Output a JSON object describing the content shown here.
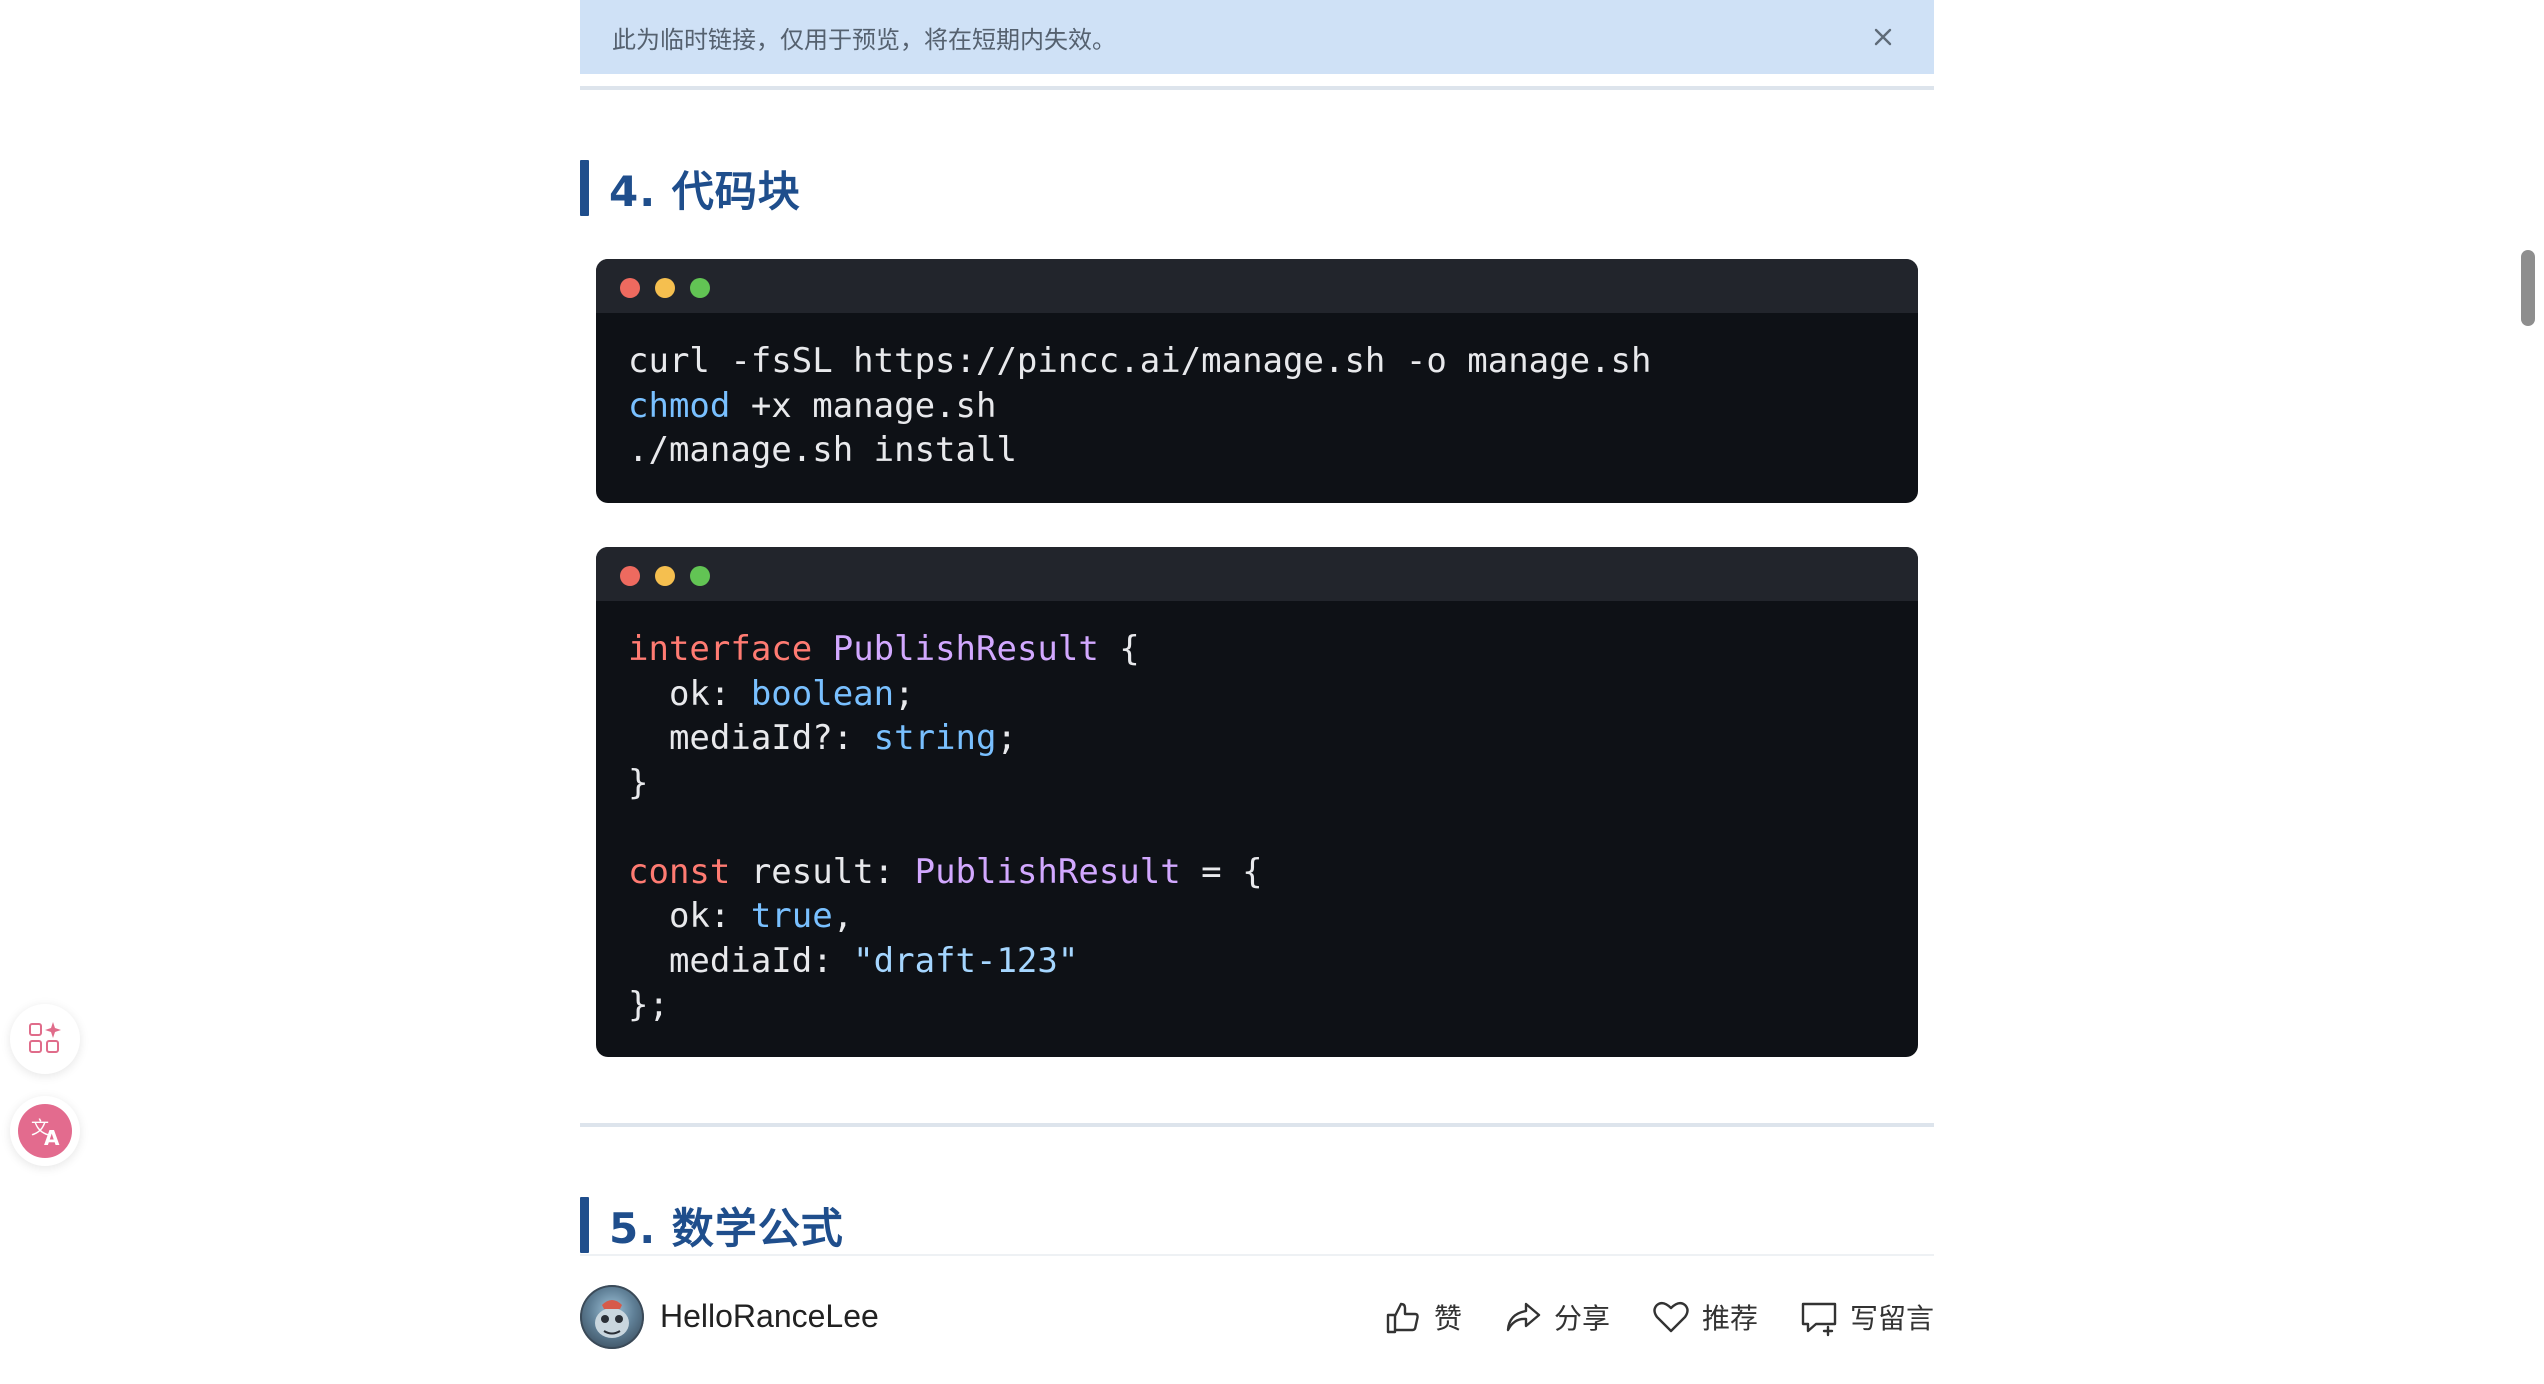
{
  "banner": {
    "text": "此为临时链接，仅用于预览，将在短期内失效。"
  },
  "sections": [
    {
      "number_title": "4. 代码块"
    },
    {
      "number_title": "5. 数学公式"
    }
  ],
  "code_blocks": [
    {
      "lines": [
        [
          {
            "t": "curl -fsSL https://pincc.ai/manage.sh -o manage.sh"
          }
        ],
        [
          {
            "t": "chmod",
            "c": "bi"
          },
          {
            "t": " +x manage.sh"
          }
        ],
        [
          {
            "t": "./manage.sh install"
          }
        ]
      ]
    },
    {
      "lines": [
        [
          {
            "t": "interface",
            "c": "kw"
          },
          {
            "t": " "
          },
          {
            "t": "PublishResult",
            "c": "type"
          },
          {
            "t": " {"
          }
        ],
        [
          {
            "t": "  ok: "
          },
          {
            "t": "boolean",
            "c": "bi"
          },
          {
            "t": ";"
          }
        ],
        [
          {
            "t": "  mediaId?: "
          },
          {
            "t": "string",
            "c": "bi"
          },
          {
            "t": ";"
          }
        ],
        [
          {
            "t": "}"
          }
        ],
        [
          {
            "t": ""
          }
        ],
        [
          {
            "t": "const",
            "c": "kw"
          },
          {
            "t": " result: "
          },
          {
            "t": "PublishResult",
            "c": "type"
          },
          {
            "t": " = {"
          }
        ],
        [
          {
            "t": "  ok: "
          },
          {
            "t": "true",
            "c": "bi"
          },
          {
            "t": ","
          }
        ],
        [
          {
            "t": "  mediaId: "
          },
          {
            "t": "\"draft-123\"",
            "c": "str"
          }
        ],
        [
          {
            "t": "};"
          }
        ]
      ]
    }
  ],
  "footer": {
    "author": "HelloRanceLee",
    "actions": [
      {
        "label": "赞",
        "icon": "thumbs-up-icon"
      },
      {
        "label": "分享",
        "icon": "share-icon"
      },
      {
        "label": "推荐",
        "icon": "heart-icon"
      },
      {
        "label": "写留言",
        "icon": "comment-icon"
      }
    ]
  },
  "colors": {
    "accent": "#1f4e8c",
    "banner_bg": "#cfe1f6",
    "code_bg": "#0e1116",
    "keyword": "#ff7b72",
    "type": "#d2a8ff",
    "builtin": "#79c0ff",
    "string": "#a5d6ff"
  }
}
